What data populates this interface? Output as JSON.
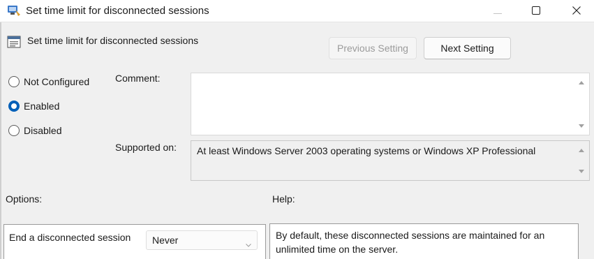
{
  "window": {
    "title": "Set time limit for disconnected sessions",
    "controls": {
      "minimize_icon": "minimize-icon",
      "maximize_icon": "maximize-icon",
      "close_icon": "close-icon"
    }
  },
  "header": {
    "policy_title": "Set time limit for disconnected sessions",
    "previous_label": "Previous Setting",
    "next_label": "Next Setting"
  },
  "state": {
    "options": [
      "Not Configured",
      "Enabled",
      "Disabled"
    ],
    "selected": "Enabled"
  },
  "comment": {
    "label": "Comment:",
    "value": ""
  },
  "supported_on": {
    "label": "Supported on:",
    "value": "At least Windows Server 2003 operating systems or Windows XP Professional"
  },
  "options_section": {
    "label": "Options:",
    "field_label": "End a disconnected session",
    "field_value": "Never"
  },
  "help_section": {
    "label": "Help:",
    "text": "By default, these disconnected sessions are maintained for an unlimited time on the server."
  },
  "colors": {
    "accent": "#005fb8",
    "background": "#f0f0f0"
  }
}
